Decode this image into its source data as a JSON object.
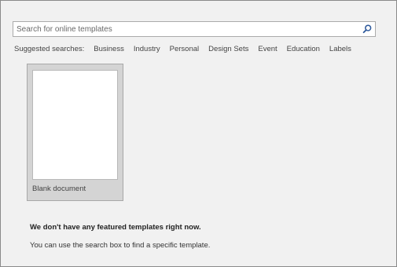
{
  "search": {
    "placeholder": "Search for online templates",
    "value": "",
    "icon": "search-icon"
  },
  "suggested": {
    "label": "Suggested searches:",
    "items": [
      "Business",
      "Industry",
      "Personal",
      "Design Sets",
      "Event",
      "Education",
      "Labels"
    ]
  },
  "templates": [
    {
      "name": "Blank document"
    }
  ],
  "message": {
    "heading": "We don't have any featured templates right now.",
    "body": "You can use the search box to find a specific template."
  },
  "colors": {
    "background": "#f1f1f1",
    "card": "#d4d4d4",
    "accent": "#2b579a"
  }
}
